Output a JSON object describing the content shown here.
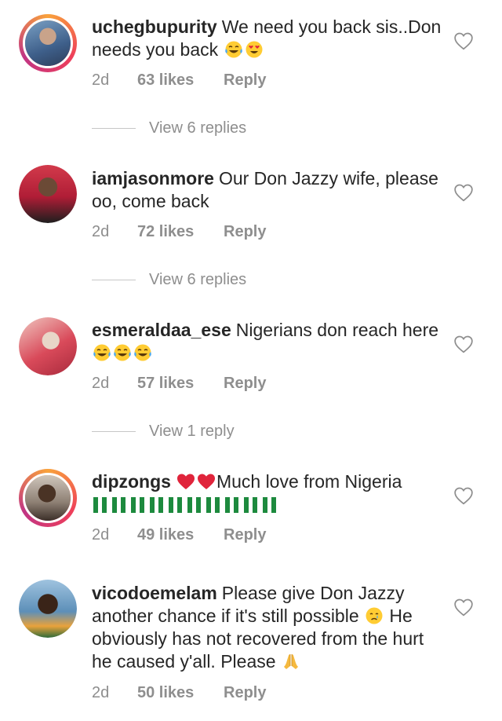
{
  "comments": [
    {
      "username": "uchegbupurity",
      "text": "We need you back sis..Don needs you back",
      "time": "2d",
      "likes": "63 likes",
      "reply": "Reply",
      "view_replies": "View 6 replies",
      "avatar_story_ring": true
    },
    {
      "username": "iamjasonmore",
      "text": "Our Don Jazzy wife, please oo, come back",
      "time": "2d",
      "likes": "72 likes",
      "reply": "Reply",
      "view_replies": "View 6 replies",
      "avatar_story_ring": false
    },
    {
      "username": "esmeraldaa_ese",
      "text": "Nigerians don reach here",
      "time": "2d",
      "likes": "57 likes",
      "reply": "Reply",
      "view_replies": "View 1 reply",
      "avatar_story_ring": false
    },
    {
      "username": "dipzongs",
      "text": "Much love from Nigeria",
      "time": "2d",
      "likes": "49 likes",
      "reply": "Reply",
      "avatar_story_ring": true
    },
    {
      "username": "vicodoemelam",
      "text_line1": "Please give Don Jazzy another chance if it's still possible",
      "text_line2": "He obviously has not recovered from the hurt he caused y'all. Please",
      "time": "2d",
      "likes": "50 likes",
      "reply": "Reply",
      "avatar_story_ring": false
    }
  ],
  "icons": {
    "like": "heart-outline-icon",
    "laugh": "tears-of-joy-emoji",
    "love": "heart-eyes-emoji",
    "heart": "red-heart-emoji",
    "flag": "nigeria-flag-emoji",
    "cry": "crying-face-emoji",
    "pray": "folded-hands-emoji"
  },
  "colors": {
    "text": "#262626",
    "secondary": "#8e8e8e",
    "red_heart": "#e0243b",
    "flag_green": "#1d8a3e"
  }
}
